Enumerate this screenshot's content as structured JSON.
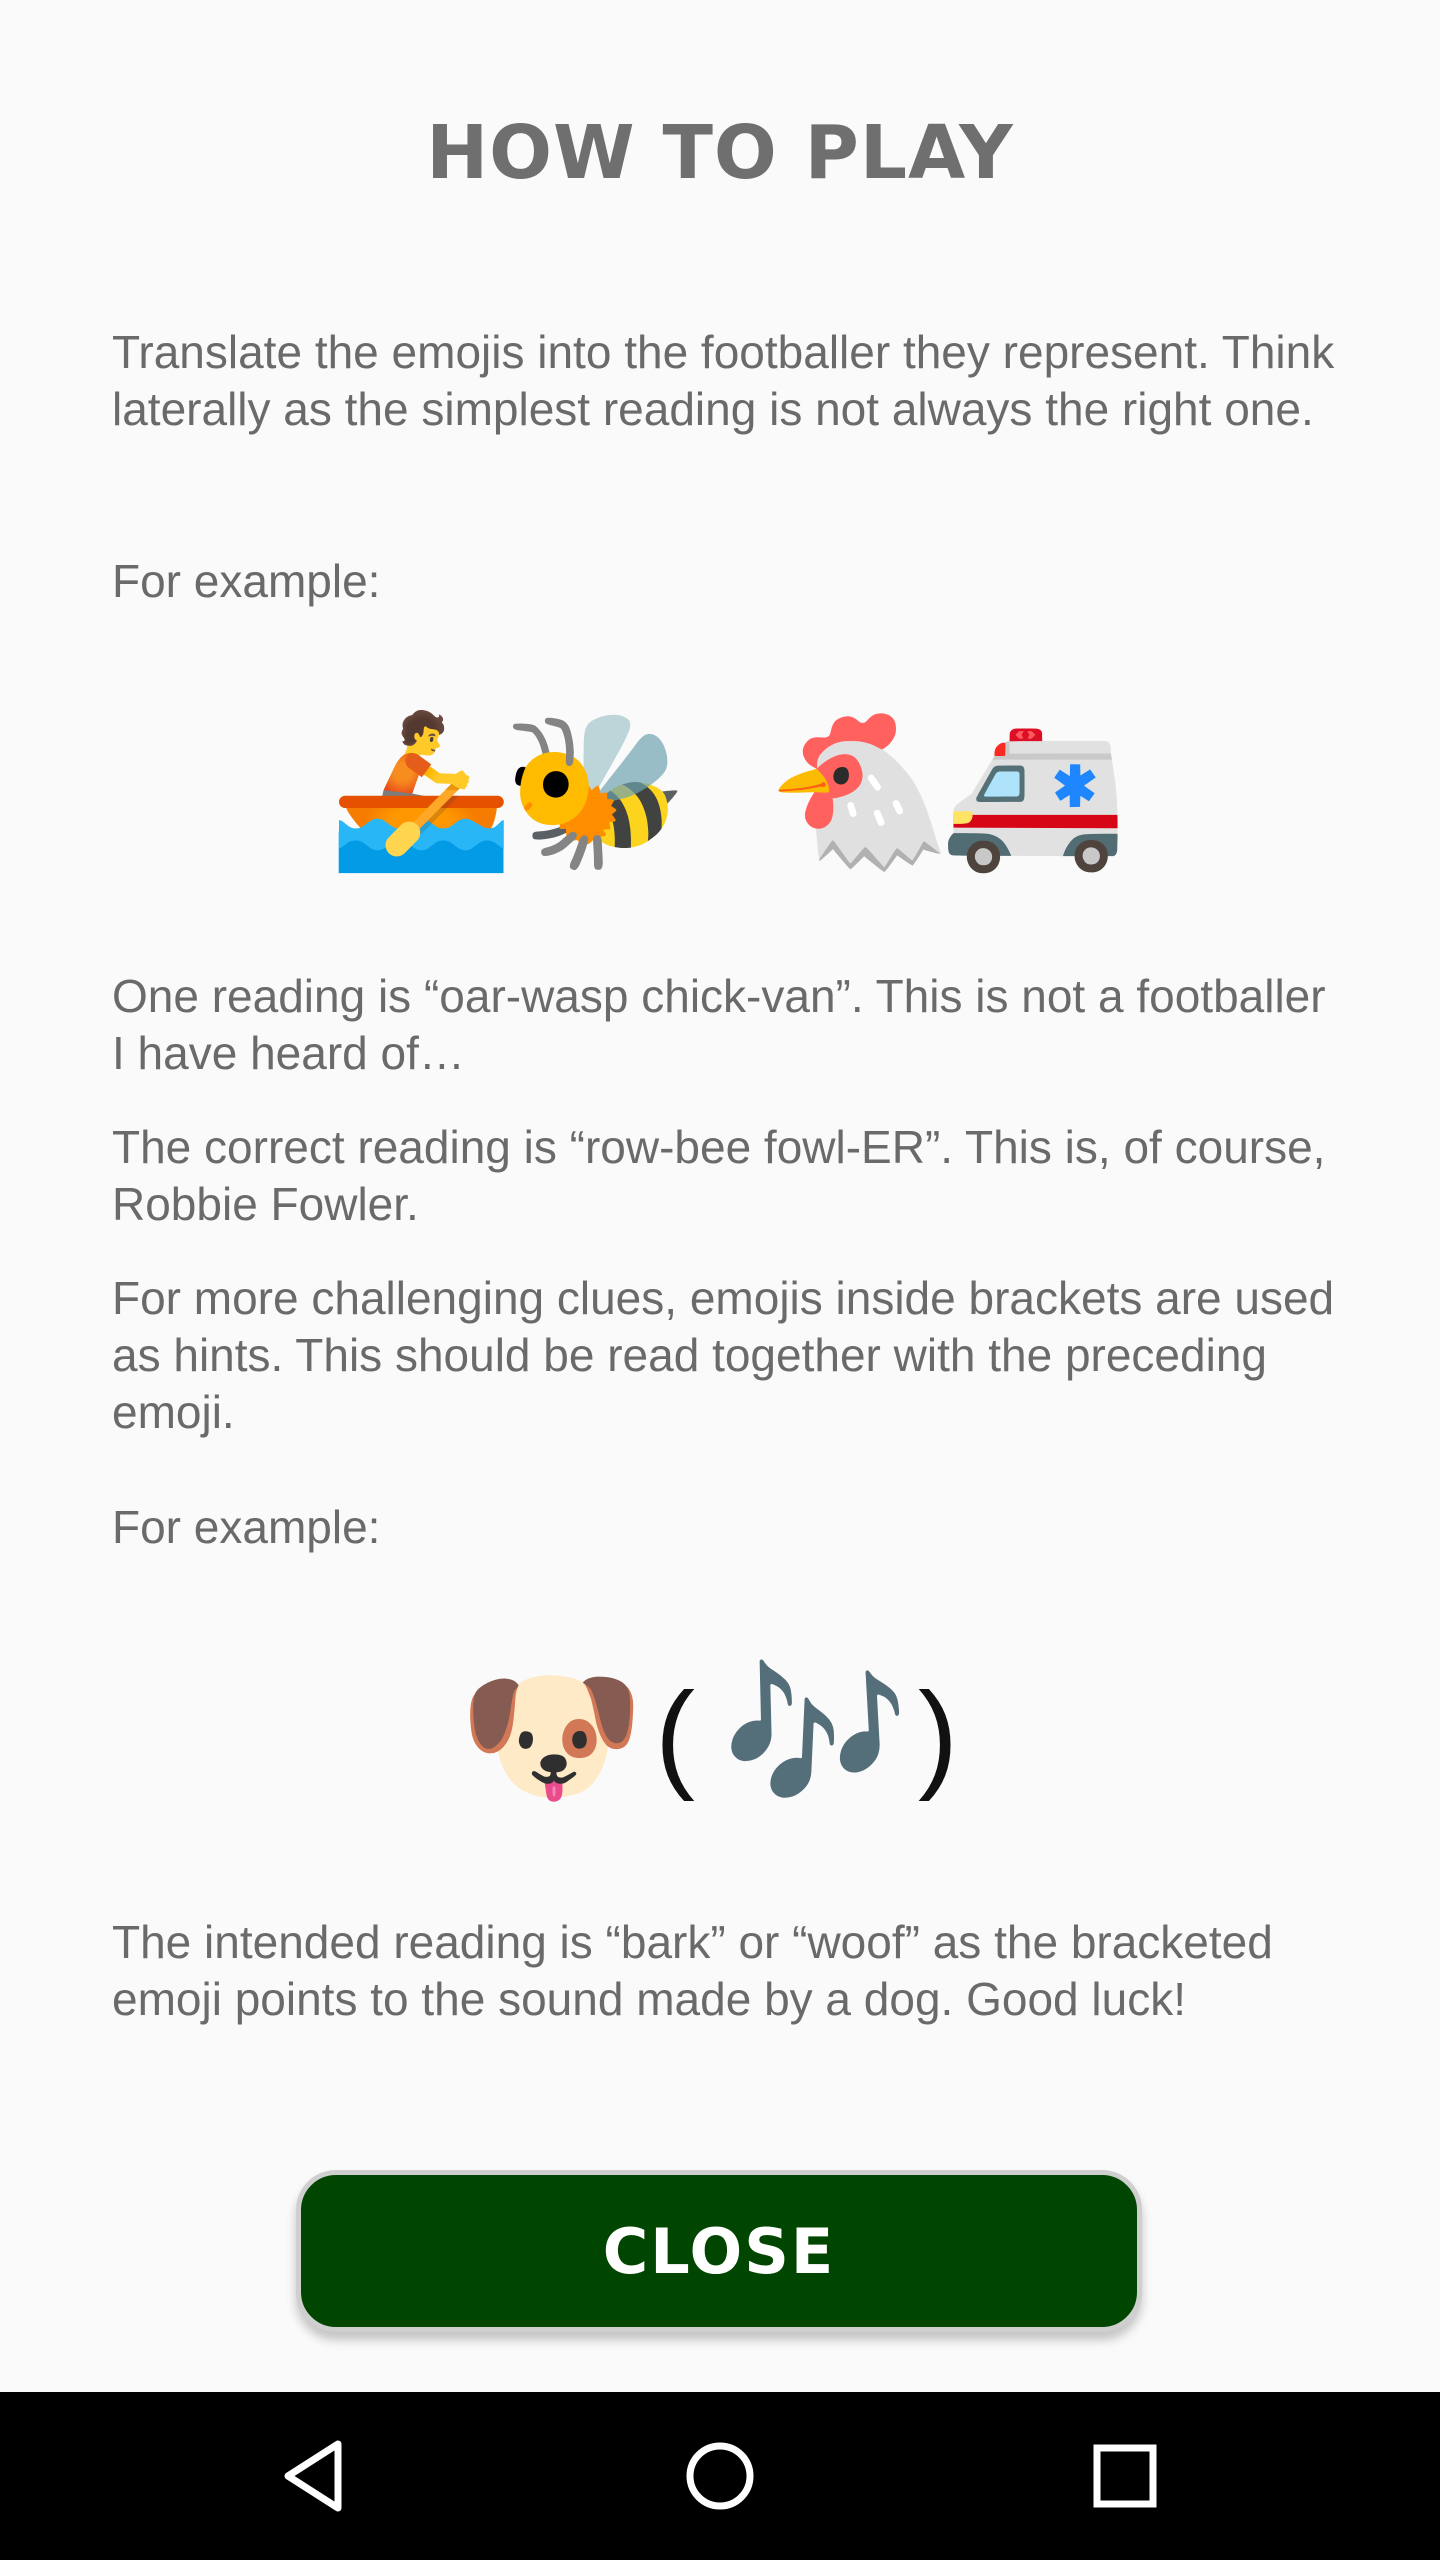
{
  "dialog": {
    "title": "HOW TO PLAY",
    "intro": "Translate the emojis into the footballer they represent. Think laterally as the simplest reading is not always the right one.",
    "example_label_1": "For example:",
    "example_1": {
      "emojis": [
        "🚣",
        "🐝",
        "🐔",
        "🚑"
      ],
      "icons": [
        "rowboat-icon",
        "bee-icon",
        "chicken-icon",
        "ambulance-icon"
      ]
    },
    "reading_wrong": "One reading is “oar-wasp chick-van”. This is not a footballer I have heard of…",
    "reading_correct": "The correct reading is “row-bee fowl-ER”. This is, of course, Robbie Fowler.",
    "brackets_explained": "For more challenging clues, emojis inside brackets are used as hints. This should be read together with the preceding emoji.",
    "example_label_2": "For example:",
    "example_2": {
      "emoji": "🐶",
      "bracket_open": "(",
      "hint_emoji": "🎶",
      "bracket_close": ")",
      "icons": [
        "dog-face-icon",
        "musical-notes-icon"
      ]
    },
    "outro": "The intended reading is “bark” or “woof” as the bracketed emoji points to the sound made by a dog. Good luck!",
    "close_label": "CLOSE"
  },
  "colors": {
    "background": "#fafafa",
    "text": "#6a6a6a",
    "button": "#004600",
    "button_text": "#ffffff",
    "navbar": "#000000"
  },
  "navbar": {
    "icons": [
      "back-icon",
      "home-icon",
      "recents-icon"
    ]
  }
}
